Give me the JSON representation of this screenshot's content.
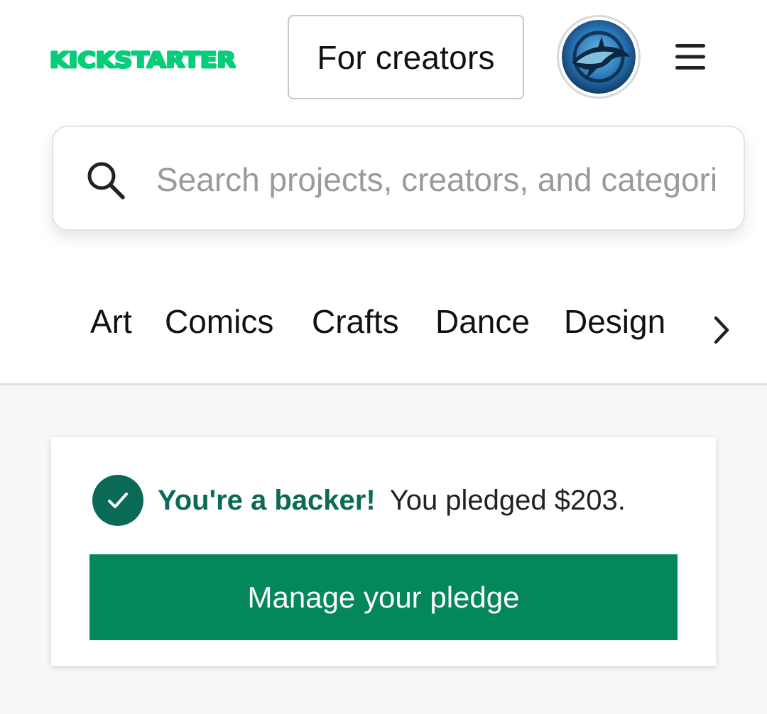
{
  "header": {
    "logo_text": "KICKSTARTER",
    "brand_color": "#05ce78",
    "creators_button": "For creators",
    "avatar_icon": "shark-avatar",
    "menu_icon": "hamburger-menu-icon"
  },
  "search": {
    "placeholder": "Search projects, creators, and categories",
    "value": ""
  },
  "categories": {
    "items": [
      "Art",
      "Comics",
      "Crafts",
      "Dance",
      "Design"
    ],
    "next_icon": "chevron-right-icon"
  },
  "backer_card": {
    "status": "You're a backer!",
    "note": "You pledged $203.",
    "button": "Manage your pledge",
    "status_color": "#0a6a55",
    "button_color": "#05875e"
  }
}
